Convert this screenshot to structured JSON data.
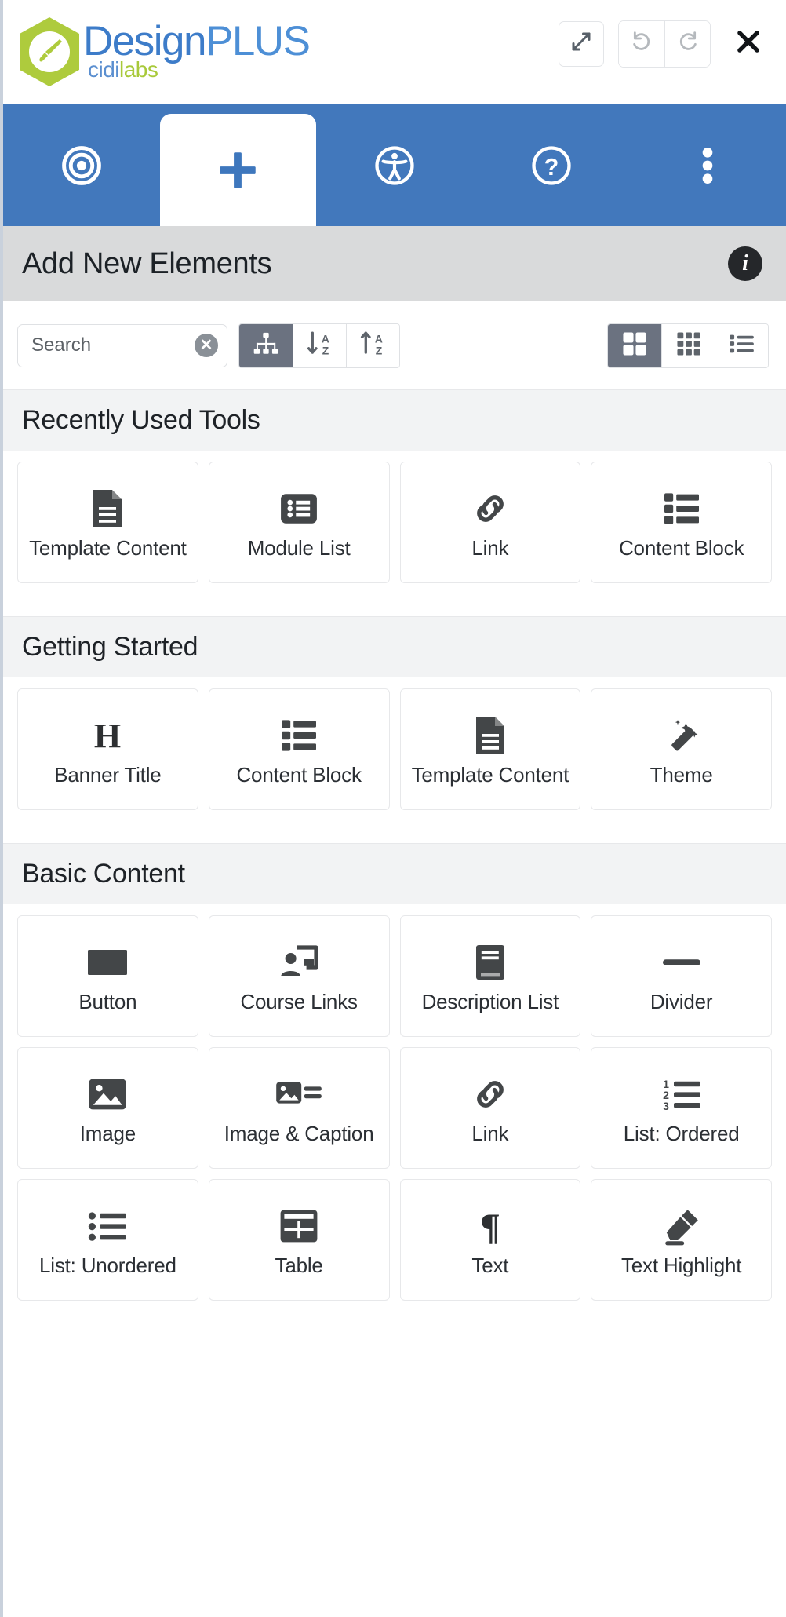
{
  "brand": {
    "title_part1": "Design",
    "title_part2": "PLUS",
    "sub_part1": "cidi",
    "sub_part2": "labs",
    "accent_green": "#a8c93a",
    "accent_blue": "#3d7cc9"
  },
  "window_controls": {
    "expand_label": "expand-arrows-icon",
    "undo_label": "undo-icon",
    "redo_label": "redo-icon",
    "close_label": "close-icon"
  },
  "tabs": [
    {
      "icon": "target-icon",
      "name": "tab-target",
      "active": false
    },
    {
      "icon": "plus-icon",
      "name": "tab-add",
      "active": true
    },
    {
      "icon": "accessibility-icon",
      "name": "tab-accessibility",
      "active": false
    },
    {
      "icon": "question-circle-icon",
      "name": "tab-help",
      "active": false
    },
    {
      "icon": "kebab-menu-icon",
      "name": "tab-more",
      "active": false
    }
  ],
  "panel": {
    "title": "Add New Elements",
    "info_icon": "info-icon",
    "info_glyph": "i"
  },
  "search": {
    "value": "",
    "placeholder": "Search",
    "clear_glyph": "✕"
  },
  "sort_group": [
    {
      "icon": "sitemap-icon",
      "name": "sort-by-group",
      "active": true
    },
    {
      "icon": "sort-alpha-down-icon",
      "name": "sort-alpha-asc",
      "active": false
    },
    {
      "icon": "sort-alpha-up-icon",
      "name": "sort-alpha-desc",
      "active": false
    }
  ],
  "view_group": [
    {
      "icon": "grid-large-icon",
      "name": "view-large-grid",
      "active": true
    },
    {
      "icon": "grid-small-icon",
      "name": "view-small-grid",
      "active": false
    },
    {
      "icon": "list-view-icon",
      "name": "view-list",
      "active": false
    }
  ],
  "sections": [
    {
      "title": "Recently Used Tools",
      "name": "section-recently-used-tools",
      "items": [
        {
          "label": "Template Content",
          "icon": "file-lines-icon"
        },
        {
          "label": "Module List",
          "icon": "list-squares-icon"
        },
        {
          "label": "Link",
          "icon": "link-chain-icon"
        },
        {
          "label": "Content Block",
          "icon": "content-block-icon"
        }
      ]
    },
    {
      "title": "Getting Started",
      "name": "section-getting-started",
      "items": [
        {
          "label": "Banner Title",
          "icon": "heading-h-icon"
        },
        {
          "label": "Content Block",
          "icon": "content-block-icon"
        },
        {
          "label": "Template Content",
          "icon": "file-lines-icon"
        },
        {
          "label": "Theme",
          "icon": "magic-wand-icon"
        }
      ]
    },
    {
      "title": "Basic Content",
      "name": "section-basic-content",
      "items": [
        {
          "label": "Button",
          "icon": "button-rect-icon"
        },
        {
          "label": "Course Links",
          "icon": "course-links-icon"
        },
        {
          "label": "Description List",
          "icon": "book-icon"
        },
        {
          "label": "Divider",
          "icon": "divider-line-icon"
        },
        {
          "label": "Image",
          "icon": "image-icon"
        },
        {
          "label": "Image & Caption",
          "icon": "image-caption-icon"
        },
        {
          "label": "Link",
          "icon": "link-chain-icon"
        },
        {
          "label": "List: Ordered",
          "icon": "list-ordered-icon"
        },
        {
          "label": "List: Unordered",
          "icon": "list-unordered-icon"
        },
        {
          "label": "Table",
          "icon": "table-icon"
        },
        {
          "label": "Text",
          "icon": "paragraph-pilcrow-icon"
        },
        {
          "label": "Text Highlight",
          "icon": "highlighter-icon"
        }
      ]
    }
  ]
}
